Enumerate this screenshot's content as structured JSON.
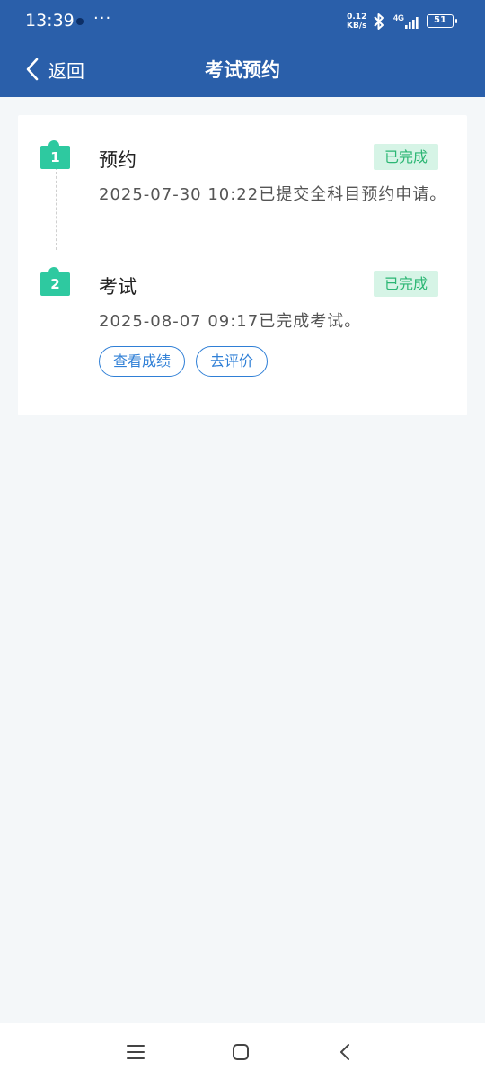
{
  "status_bar": {
    "time": "13:39",
    "more": "···",
    "speed_value": "0.12",
    "speed_unit": "KB/s",
    "network": "4G",
    "battery": "51"
  },
  "nav": {
    "back_label": "返回",
    "title": "考试预约"
  },
  "steps": [
    {
      "number": "1",
      "title": "预约",
      "status": "已完成",
      "desc": "2025-07-30 10:22已提交全科目预约申请。"
    },
    {
      "number": "2",
      "title": "考试",
      "status": "已完成",
      "desc": "2025-08-07 09:17已完成考试。",
      "actions": [
        "查看成绩",
        "去评价"
      ]
    }
  ],
  "colors": {
    "header": "#2a5faa",
    "badge": "#2ec9a0",
    "tag_bg": "#d6f4e6",
    "tag_text": "#2bb673",
    "link": "#2f7fd6"
  },
  "icons": {
    "back": "chevron-left-icon",
    "bluetooth": "bluetooth-icon",
    "signal": "signal-icon",
    "menu": "menu-icon",
    "home": "home-icon",
    "nav_back": "back-icon"
  }
}
